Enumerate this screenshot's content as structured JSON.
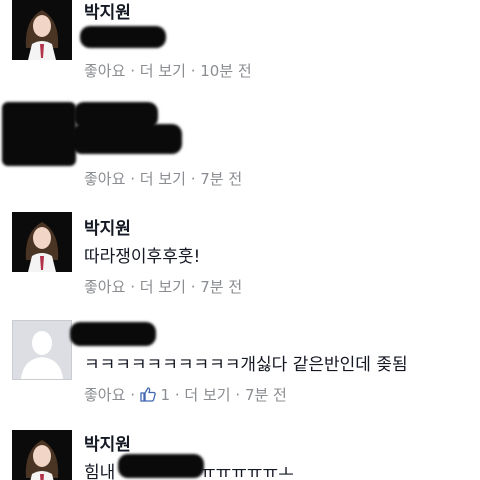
{
  "comments": [
    {
      "author": "박지원",
      "text": "",
      "like_label": "좋아요",
      "more_label": "더 보기",
      "time": "10분 전"
    },
    {
      "author": "",
      "text": "",
      "like_label": "좋아요",
      "more_label": "더 보기",
      "time": "7분 전"
    },
    {
      "author": "박지원",
      "text": "따라쟁이후후훗!",
      "like_label": "좋아요",
      "more_label": "더 보기",
      "time": "7분 전"
    },
    {
      "author": "",
      "text": "ㅋㅋㅋㅋㅋㅋㅋㅋㅋㅋ개싫다 같은반인데 좆됨",
      "like_label": "좋아요",
      "like_count": "1",
      "more_label": "더 보기",
      "time": "7분 전"
    },
    {
      "author": "박지원",
      "text_start": "힘내",
      "text_end": "ㅠㅠㅠㅠㅠㅗ"
    }
  ],
  "separator": "·",
  "colors": {
    "meta": "#8a8d91",
    "like_icon": "#4267b2"
  }
}
